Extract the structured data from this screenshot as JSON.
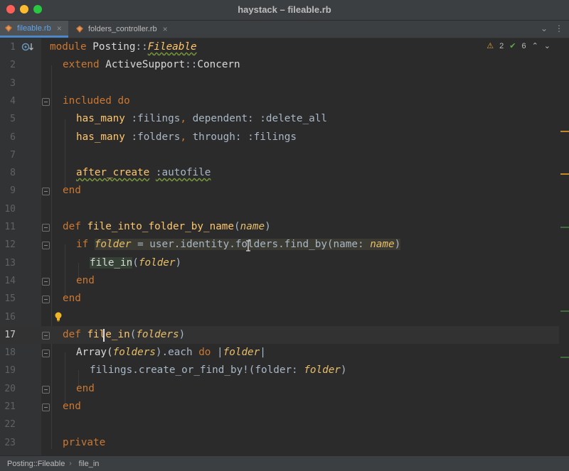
{
  "window": {
    "title": "haystack – fileable.rb"
  },
  "tabs": [
    {
      "label": "fileable.rb",
      "active": true,
      "icon": "ruby-file-icon"
    },
    {
      "label": "folders_controller.rb",
      "active": false,
      "icon": "ruby-file-icon"
    }
  ],
  "inspections": {
    "warnings": "2",
    "ok": "6"
  },
  "line_numbers": [
    "1",
    "2",
    "3",
    "4",
    "5",
    "6",
    "7",
    "8",
    "9",
    "10",
    "11",
    "12",
    "13",
    "14",
    "15",
    "16",
    "17",
    "18",
    "19",
    "20",
    "21",
    "22",
    "23"
  ],
  "code": {
    "l1": {
      "kw": "module",
      "ns": "Posting",
      "sep": "::",
      "mod": "Fileable"
    },
    "l2": {
      "kw": "extend",
      "rest1": "ActiveSupport",
      "sep": "::",
      "rest2": "Concern"
    },
    "l4": {
      "kw": "included",
      "kw2": "do"
    },
    "l5": {
      "meth": "has_many",
      "sym1": ":filings",
      "comma": ",",
      "key": "dependent:",
      "sym2": ":delete_all"
    },
    "l6": {
      "meth": "has_many",
      "sym1": ":folders",
      "comma": ",",
      "key": "through:",
      "sym2": ":filings"
    },
    "l8": {
      "meth": "after_create",
      "sym": ":autofile"
    },
    "l9": {
      "kw": "end"
    },
    "l11": {
      "kw": "def",
      "name": "file_into_folder_by_name",
      "open": "(",
      "param": "name",
      "close": ")"
    },
    "l12": {
      "kw": "if",
      "var": "folder",
      "rest": "= user.identity.folders.find_by(name:",
      "param": "name",
      "close": ")"
    },
    "l13": {
      "call": "file_in",
      "open": "(",
      "var": "folder",
      "close": ")"
    },
    "l14": {
      "kw": "end"
    },
    "l15": {
      "kw": "end"
    },
    "l17": {
      "kw": "def",
      "name": "file_in",
      "open": "(",
      "param": "folders",
      "close": ")"
    },
    "l18": {
      "a": "Array(",
      "param": "folders",
      "b": ").each",
      "kw": "do",
      "c": "|",
      "var": "folder",
      "d": "|"
    },
    "l19": {
      "a": "filings.create_or_find_by!(folder:",
      "param": "folder",
      "close": ")"
    },
    "l20": {
      "kw": "end"
    },
    "l21": {
      "kw": "end"
    },
    "l23": {
      "kw": "private"
    }
  },
  "breadcrumb": [
    "Posting::Fileable",
    "file_in"
  ],
  "colors": {
    "keyword": "#cc7832",
    "symbol": "#9876aa",
    "param": "#e8bf6a",
    "accent": "#4a88c7"
  }
}
